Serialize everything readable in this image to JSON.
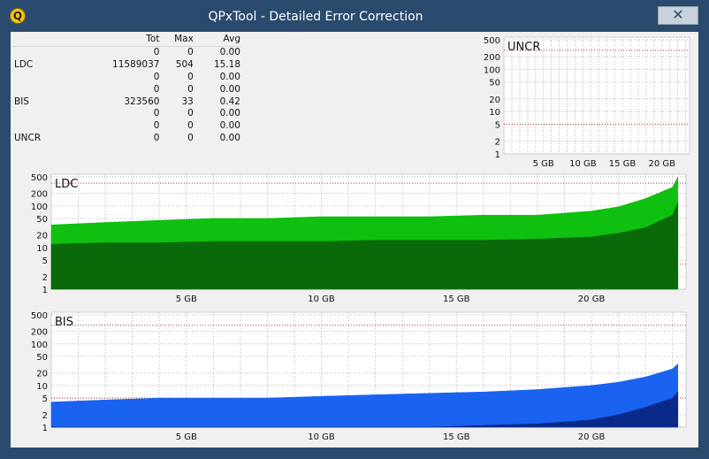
{
  "window": {
    "title": "QPxTool - Detailed Error Correction",
    "app_icon_letter": "Q",
    "close_glyph": "✕"
  },
  "stats": {
    "headers": [
      "",
      "Tot",
      "Max",
      "Avg"
    ],
    "rows": [
      {
        "label": "",
        "tot": "0",
        "max": "0",
        "avg": "0.00"
      },
      {
        "label": "LDC",
        "tot": "11589037",
        "max": "504",
        "avg": "15.18"
      },
      {
        "label": "",
        "tot": "0",
        "max": "0",
        "avg": "0.00"
      },
      {
        "label": "",
        "tot": "0",
        "max": "0",
        "avg": "0.00"
      },
      {
        "label": "BIS",
        "tot": "323560",
        "max": "33",
        "avg": "0.42"
      },
      {
        "label": "",
        "tot": "0",
        "max": "0",
        "avg": "0.00"
      },
      {
        "label": "",
        "tot": "0",
        "max": "0",
        "avg": "0.00"
      },
      {
        "label": "UNCR",
        "tot": "0",
        "max": "0",
        "avg": "0.00"
      }
    ]
  },
  "colors": {
    "ldc_bright": "#10c010",
    "ldc_dark": "#0a6a0a",
    "bis_bright": "#1a62f0",
    "bis_dark": "#0a2a8a",
    "threshold": "#c03030",
    "grid": "#b8b8b8",
    "window_frame": "#2b4b6e"
  },
  "chart_data": [
    {
      "name": "UNCR",
      "title": "UNCR",
      "type": "area",
      "scale": "log",
      "y_ticks": [
        1,
        2,
        5,
        10,
        20,
        50,
        100,
        200,
        500
      ],
      "x_ticks": [
        "5 GB",
        "10 GB",
        "15 GB",
        "20 GB"
      ],
      "x_tick_values": [
        5,
        10,
        15,
        20
      ],
      "xlim": [
        0,
        23.5
      ],
      "ylim": [
        1,
        500
      ],
      "thresholds": [
        5,
        280
      ],
      "series": []
    },
    {
      "name": "LDC",
      "title": "LDC",
      "type": "area",
      "scale": "log",
      "y_ticks": [
        1,
        2,
        5,
        10,
        20,
        50,
        100,
        200,
        500
      ],
      "x_ticks": [
        "5 GB",
        "10 GB",
        "15 GB",
        "20 GB"
      ],
      "x_tick_values": [
        5,
        10,
        15,
        20
      ],
      "xlim": [
        0,
        23.5
      ],
      "ylim": [
        1,
        500
      ],
      "thresholds": [
        4,
        350
      ],
      "series": [
        {
          "x": [
            0,
            2,
            4,
            6,
            8,
            10,
            12,
            14,
            16,
            18,
            20,
            21,
            22,
            23,
            23.2
          ],
          "max": [
            35,
            40,
            45,
            50,
            50,
            55,
            55,
            55,
            60,
            60,
            75,
            95,
            150,
            280,
            500
          ],
          "avg": [
            12,
            13,
            13,
            14,
            14,
            14,
            15,
            15,
            15,
            16,
            18,
            22,
            30,
            60,
            120
          ]
        }
      ]
    },
    {
      "name": "BIS",
      "title": "BIS",
      "type": "area",
      "scale": "log",
      "y_ticks": [
        1,
        2,
        5,
        10,
        20,
        50,
        100,
        200,
        500
      ],
      "x_ticks": [
        "5 GB",
        "10 GB",
        "15 GB",
        "20 GB"
      ],
      "x_tick_values": [
        5,
        10,
        15,
        20
      ],
      "xlim": [
        0,
        23.5
      ],
      "ylim": [
        1,
        500
      ],
      "thresholds": [
        5,
        280
      ],
      "series": [
        {
          "x": [
            0,
            2,
            4,
            6,
            8,
            10,
            12,
            14,
            16,
            18,
            20,
            21,
            22,
            23,
            23.2
          ],
          "max": [
            4,
            4.5,
            5,
            5,
            5,
            5.5,
            6,
            6.5,
            7,
            8,
            10,
            12,
            16,
            25,
            33
          ],
          "avg": [
            1,
            1,
            1,
            1,
            1,
            1,
            1,
            1,
            1.1,
            1.2,
            1.5,
            2,
            3,
            5,
            7
          ]
        }
      ]
    }
  ]
}
